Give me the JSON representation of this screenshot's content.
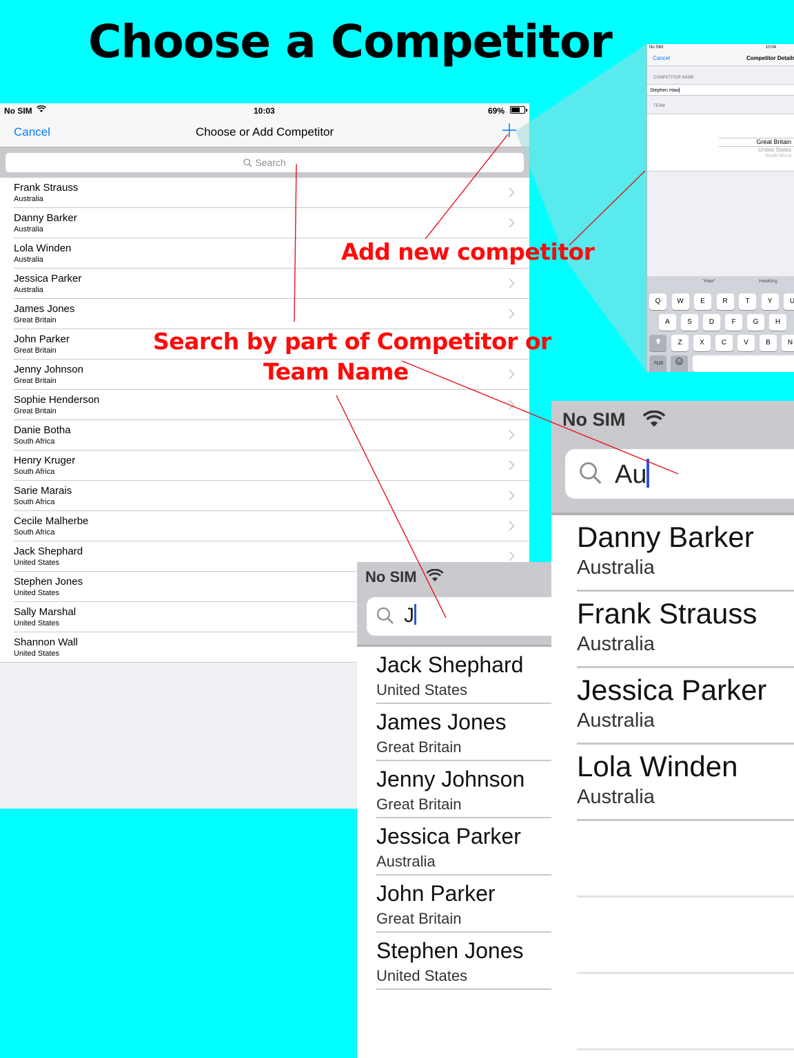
{
  "headline": "Choose a Competitor",
  "main": {
    "status": {
      "carrier": "No SIM",
      "time": "10:03",
      "battery": "69%",
      "battery_level": 0.69
    },
    "nav": {
      "cancel": "Cancel",
      "title": "Choose or Add Competitor",
      "add_icon": "plus-icon"
    },
    "search_placeholder": "Search",
    "rows": [
      {
        "name": "Frank Strauss",
        "team": "Australia"
      },
      {
        "name": "Danny Barker",
        "team": "Australia"
      },
      {
        "name": "Lola Winden",
        "team": "Australia"
      },
      {
        "name": "Jessica Parker",
        "team": "Australia"
      },
      {
        "name": "James Jones",
        "team": "Great Britain"
      },
      {
        "name": "John Parker",
        "team": "Great Britain"
      },
      {
        "name": "Jenny Johnson",
        "team": "Great Britain"
      },
      {
        "name": "Sophie Henderson",
        "team": "Great Britain"
      },
      {
        "name": "Danie Botha",
        "team": "South Africa"
      },
      {
        "name": "Henry Kruger",
        "team": "South Africa"
      },
      {
        "name": "Sarie Marais",
        "team": "South Africa"
      },
      {
        "name": "Cecile Malherbe",
        "team": "South Africa"
      },
      {
        "name": "Jack Shephard",
        "team": "United States"
      },
      {
        "name": "Stephen Jones",
        "team": "United States"
      },
      {
        "name": "Sally Marshal",
        "team": "United States"
      },
      {
        "name": "Shannon Wall",
        "team": "United States"
      }
    ]
  },
  "details": {
    "status": {
      "carrier": "No SIM",
      "time": "10:04"
    },
    "cancel": "Cancel",
    "title": "Competitor Details",
    "name_label": "COMPETITOR NAME",
    "name_value": "Stephen Haw",
    "team_label": "TEAM",
    "picker": [
      "Great Britain",
      "United States",
      "South Africa"
    ],
    "suggestions": [
      "\"Haw\"",
      "Hawking"
    ],
    "keys_row1": [
      "Q",
      "W",
      "E",
      "R",
      "T",
      "Y",
      "U"
    ],
    "keys_row2": [
      "A",
      "S",
      "D",
      "F",
      "G",
      "H"
    ],
    "keys_row3": [
      "Z",
      "X",
      "C",
      "V",
      "B",
      "N"
    ],
    "key_numbers": ".?123"
  },
  "j_search": {
    "carrier": "No SIM",
    "query": "J",
    "results": [
      {
        "name": "Jack Shephard",
        "team": "United States"
      },
      {
        "name": "James Jones",
        "team": "Great Britain"
      },
      {
        "name": "Jenny Johnson",
        "team": "Great Britain"
      },
      {
        "name": "Jessica Parker",
        "team": "Australia"
      },
      {
        "name": "John Parker",
        "team": "Great Britain"
      },
      {
        "name": "Stephen Jones",
        "team": "United States"
      }
    ]
  },
  "au_search": {
    "carrier": "No SIM",
    "query": "Au",
    "results": [
      {
        "name": "Danny Barker",
        "team": "Australia"
      },
      {
        "name": "Frank Strauss",
        "team": "Australia"
      },
      {
        "name": "Jessica Parker",
        "team": "Australia"
      },
      {
        "name": "Lola Winden",
        "team": "Australia"
      }
    ]
  },
  "callouts": {
    "add": "Add new competitor",
    "search_line1": "Search by part of Competitor or",
    "search_line2": "Team Name"
  },
  "colors": {
    "background": "#00ffff",
    "accent": "#007aff",
    "callout": "#ff0a0a"
  }
}
